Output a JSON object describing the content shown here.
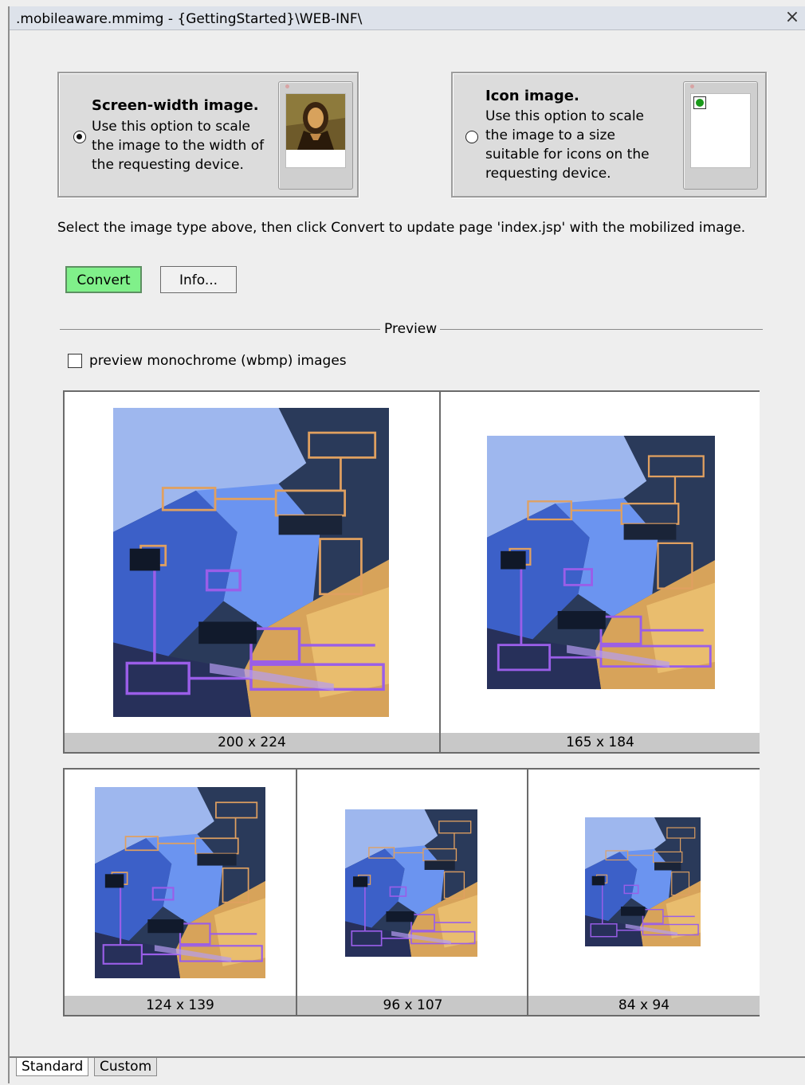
{
  "window": {
    "title": ".mobileaware.mmimg - {GettingStarted}\\WEB-INF\\",
    "close_icon": "close-icon"
  },
  "options": {
    "screen_width": {
      "title": "Screen-width image.",
      "description": "Use this option to scale the image to the width of the requesting device.",
      "selected": true,
      "preview_icon": "mona-lisa-phone-icon"
    },
    "icon": {
      "title": "Icon image.",
      "description": "Use this option to scale the image to a size suitable for icons on the requesting device.",
      "selected": false,
      "preview_icon": "green-dot-phone-icon"
    }
  },
  "instruction": "Select the image type above, then click Convert to update page 'index.jsp' with the mobilized image.",
  "buttons": {
    "convert": "Convert",
    "info": "Info..."
  },
  "preview": {
    "label": "Preview",
    "monochrome_checkbox_label": "preview monochrome (wbmp) images",
    "monochrome_checked": false,
    "sizes_row1": [
      "200 x 224",
      "165 x 184"
    ],
    "sizes_row2": [
      "124 x 139",
      "96 x 107",
      "84 x 94"
    ]
  },
  "tabs": {
    "standard": "Standard",
    "custom": "Custom",
    "active": "Standard"
  },
  "colors": {
    "convert_button": "#80f08a",
    "thumb_blue": "#3f6fd8",
    "thumb_orange": "#d8a058",
    "thumb_purple": "#8a4fd0"
  }
}
